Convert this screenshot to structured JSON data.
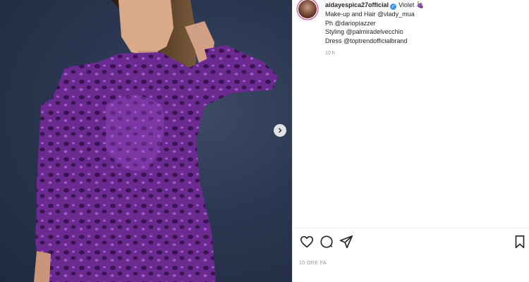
{
  "caption": {
    "username": "aidayespica27official",
    "text": "Violet",
    "emoji": "🍇",
    "lines": [
      "Make-up and Hair @vlady_mua",
      "Ph @dariopiazzer",
      "Styling @palmiradelvecchio",
      "Dress @toptrendofficialbrand"
    ],
    "time": "10 h"
  },
  "footer": {
    "date": "10 ORE FA"
  },
  "icons": {
    "like": "heart-icon",
    "comment": "comment-icon",
    "share": "share-icon",
    "save": "bookmark-icon",
    "next": "chevron-right-icon",
    "verified": "verified-badge-icon"
  },
  "colors": {
    "dress": "#7b2fbe",
    "backdrop": "#2b3750",
    "verified": "#3897f0",
    "text": "#262626",
    "muted": "#8e8e8e"
  }
}
